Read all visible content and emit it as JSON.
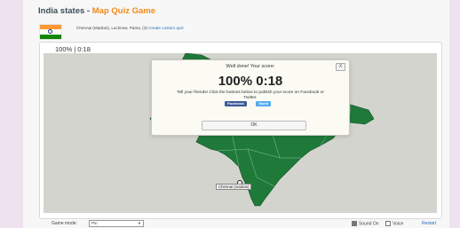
{
  "header": {
    "title_main": "India states",
    "title_sep": " - ",
    "title_accent": "Map Quiz Game",
    "subtitle_cities": "Chennai (Madras), Lucknow, Patna, (3)",
    "subtitle_link": "Create custom quiz"
  },
  "flag": {
    "colors": [
      "#ff9933",
      "#ffffff",
      "#138808"
    ],
    "wheel": "#1a2c8a"
  },
  "status": {
    "score_time": "100% | 0:18"
  },
  "map": {
    "land_color": "#1f7a3a",
    "water_color": "#d4d4ce",
    "city_label": "Chennai (madras)"
  },
  "modal": {
    "heading": "Well done! Your score:",
    "close_label": "X",
    "score": "100% 0:18",
    "message": "Tell your friends! Click the buttons below to publish your score on Facebook or Twitter.",
    "facebook_label": "Facebook",
    "twitter_label": "Tweet",
    "ok_label": "OK"
  },
  "footer": {
    "mode_label": "Game mode:",
    "mode_value": "Pin",
    "sound_label": "Sound On",
    "voice_label": "Voice",
    "restart_label": "Restart"
  }
}
